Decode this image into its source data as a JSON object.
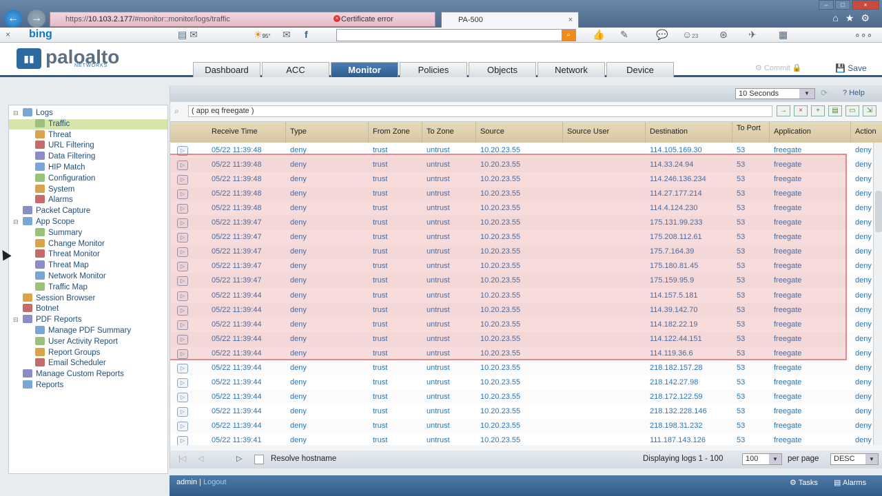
{
  "browser": {
    "url_host": "10.103.2.177",
    "url_path": "/#monitor::monitor/logs/traffic",
    "url_scheme": "https://",
    "cert_error": "Certificate error",
    "tab_title": "PA-500"
  },
  "bing": {
    "logo": "bing",
    "weather": "95°",
    "mail_count": "23"
  },
  "header": {
    "logo_text": "paloalto",
    "logo_sub": "NETWORKS",
    "tabs": [
      "Dashboard",
      "ACC",
      "Monitor",
      "Policies",
      "Objects",
      "Network",
      "Device"
    ],
    "active_tab": "Monitor",
    "commit_label": "Commit",
    "save_label": "Save"
  },
  "sidebar": {
    "items": [
      {
        "label": "Logs",
        "level": 0
      },
      {
        "label": "Traffic",
        "level": 1
      },
      {
        "label": "Threat",
        "level": 1
      },
      {
        "label": "URL Filtering",
        "level": 1
      },
      {
        "label": "Data Filtering",
        "level": 1
      },
      {
        "label": "HIP Match",
        "level": 1
      },
      {
        "label": "Configuration",
        "level": 1
      },
      {
        "label": "System",
        "level": 1
      },
      {
        "label": "Alarms",
        "level": 1
      },
      {
        "label": "Packet Capture",
        "level": 0
      },
      {
        "label": "App Scope",
        "level": 0
      },
      {
        "label": "Summary",
        "level": 1
      },
      {
        "label": "Change Monitor",
        "level": 1
      },
      {
        "label": "Threat Monitor",
        "level": 1
      },
      {
        "label": "Threat Map",
        "level": 1
      },
      {
        "label": "Network Monitor",
        "level": 1
      },
      {
        "label": "Traffic Map",
        "level": 1
      },
      {
        "label": "Session Browser",
        "level": 0
      },
      {
        "label": "Botnet",
        "level": 0
      },
      {
        "label": "PDF Reports",
        "level": 0
      },
      {
        "label": "Manage PDF Summary",
        "level": 1
      },
      {
        "label": "User Activity Report",
        "level": 1
      },
      {
        "label": "Report Groups",
        "level": 1
      },
      {
        "label": "Email Scheduler",
        "level": 1
      },
      {
        "label": "Manage Custom Reports",
        "level": 0
      },
      {
        "label": "Reports",
        "level": 0
      }
    ],
    "selected": "Traffic"
  },
  "toolbar": {
    "refresh_interval": "10 Seconds",
    "help_label": "Help"
  },
  "filter": {
    "query": "( app eq freegate )"
  },
  "grid": {
    "columns": [
      "Receive Time",
      "Type",
      "From Zone",
      "To Zone",
      "Source",
      "Source User",
      "Destination",
      "To Port",
      "Application",
      "Action"
    ],
    "rows": [
      [
        "05/22 11:39:48",
        "deny",
        "trust",
        "untrust",
        "10.20.23.55",
        "",
        "114.105.169.30",
        "53",
        "freegate",
        "deny"
      ],
      [
        "05/22 11:39:48",
        "deny",
        "trust",
        "untrust",
        "10.20.23.55",
        "",
        "114.33.24.94",
        "53",
        "freegate",
        "deny"
      ],
      [
        "05/22 11:39:48",
        "deny",
        "trust",
        "untrust",
        "10.20.23.55",
        "",
        "114.246.136.234",
        "53",
        "freegate",
        "deny"
      ],
      [
        "05/22 11:39:48",
        "deny",
        "trust",
        "untrust",
        "10.20.23.55",
        "",
        "114.27.177.214",
        "53",
        "freegate",
        "deny"
      ],
      [
        "05/22 11:39:48",
        "deny",
        "trust",
        "untrust",
        "10.20.23.55",
        "",
        "114.4.124.230",
        "53",
        "freegate",
        "deny"
      ],
      [
        "05/22 11:39:47",
        "deny",
        "trust",
        "untrust",
        "10.20.23.55",
        "",
        "175.131.99.233",
        "53",
        "freegate",
        "deny"
      ],
      [
        "05/22 11:39:47",
        "deny",
        "trust",
        "untrust",
        "10.20.23.55",
        "",
        "175.208.112.61",
        "53",
        "freegate",
        "deny"
      ],
      [
        "05/22 11:39:47",
        "deny",
        "trust",
        "untrust",
        "10.20.23.55",
        "",
        "175.7.164.39",
        "53",
        "freegate",
        "deny"
      ],
      [
        "05/22 11:39:47",
        "deny",
        "trust",
        "untrust",
        "10.20.23.55",
        "",
        "175.180.81.45",
        "53",
        "freegate",
        "deny"
      ],
      [
        "05/22 11:39:47",
        "deny",
        "trust",
        "untrust",
        "10.20.23.55",
        "",
        "175.159.95.9",
        "53",
        "freegate",
        "deny"
      ],
      [
        "05/22 11:39:44",
        "deny",
        "trust",
        "untrust",
        "10.20.23.55",
        "",
        "114.157.5.181",
        "53",
        "freegate",
        "deny"
      ],
      [
        "05/22 11:39:44",
        "deny",
        "trust",
        "untrust",
        "10.20.23.55",
        "",
        "114.39.142.70",
        "53",
        "freegate",
        "deny"
      ],
      [
        "05/22 11:39:44",
        "deny",
        "trust",
        "untrust",
        "10.20.23.55",
        "",
        "114.182.22.19",
        "53",
        "freegate",
        "deny"
      ],
      [
        "05/22 11:39:44",
        "deny",
        "trust",
        "untrust",
        "10.20.23.55",
        "",
        "114.122.44.151",
        "53",
        "freegate",
        "deny"
      ],
      [
        "05/22 11:39:44",
        "deny",
        "trust",
        "untrust",
        "10.20.23.55",
        "",
        "114.119.36.6",
        "53",
        "freegate",
        "deny"
      ],
      [
        "05/22 11:39:44",
        "deny",
        "trust",
        "untrust",
        "10.20.23.55",
        "",
        "218.182.157.28",
        "53",
        "freegate",
        "deny"
      ],
      [
        "05/22 11:39:44",
        "deny",
        "trust",
        "untrust",
        "10.20.23.55",
        "",
        "218.142.27.98",
        "53",
        "freegate",
        "deny"
      ],
      [
        "05/22 11:39:44",
        "deny",
        "trust",
        "untrust",
        "10.20.23.55",
        "",
        "218.172.122.59",
        "53",
        "freegate",
        "deny"
      ],
      [
        "05/22 11:39:44",
        "deny",
        "trust",
        "untrust",
        "10.20.23.55",
        "",
        "218.132.228.146",
        "53",
        "freegate",
        "deny"
      ],
      [
        "05/22 11:39:44",
        "deny",
        "trust",
        "untrust",
        "10.20.23.55",
        "",
        "218.198.31.232",
        "53",
        "freegate",
        "deny"
      ],
      [
        "05/22 11:39:41",
        "deny",
        "trust",
        "untrust",
        "10.20.23.55",
        "",
        "111.187.143.126",
        "53",
        "freegate",
        "deny"
      ]
    ]
  },
  "pager": {
    "resolve_label": "Resolve hostname",
    "display_text": "Displaying logs 1 - 100",
    "per_page_value": "100",
    "per_page_label": "per page",
    "sort_value": "DESC"
  },
  "status": {
    "user": "admin",
    "logout": "Logout",
    "tasks": "Tasks",
    "alarms": "Alarms"
  }
}
